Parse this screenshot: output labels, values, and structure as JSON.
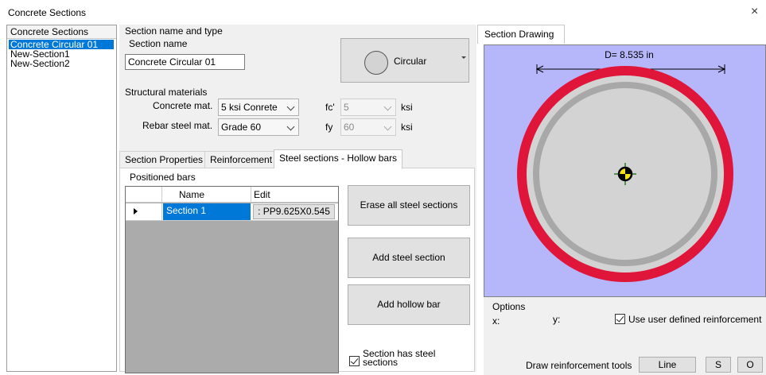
{
  "window": {
    "title": "Concrete Sections",
    "close_glyph": "×"
  },
  "sections_list": {
    "header": "Concrete Sections",
    "items": [
      "Concrete Circular 01",
      "New-Section1",
      "New-Section2"
    ],
    "selected_index": 0
  },
  "section_name_type": {
    "group_label": "Section name and type",
    "name_label": "Section name",
    "name_value": "Concrete Circular 01",
    "type_label": "Circular"
  },
  "materials": {
    "group_label": "Structural materials",
    "concrete_label": "Concrete mat.",
    "concrete_value": "5 ksi Conrete",
    "rebar_label": "Rebar steel mat.",
    "rebar_value": "Grade 60",
    "fc_label": "fc'",
    "fc_value": "5",
    "fy_label": "fy",
    "fy_value": "60",
    "unit_fc": "ksi",
    "unit_fy": "ksi"
  },
  "tabs": [
    {
      "label": "Section Properties",
      "active": false
    },
    {
      "label": "Reinforcement",
      "active": false
    },
    {
      "label": "Steel sections - Hollow bars",
      "active": true
    }
  ],
  "positioned_bars": {
    "group_label": "Positioned bars",
    "columns": [
      "Name",
      "Edit"
    ],
    "rows": [
      {
        "name": "Section 1",
        "edit": ": PP9.625X0.545"
      }
    ]
  },
  "buttons": {
    "erase_all": "Erase all steel sections",
    "add_steel": "Add steel section",
    "add_hollow": "Add hollow bar"
  },
  "has_steel": {
    "label_line1": "Section has steel",
    "label_line2": "sections",
    "checked": true
  },
  "drawing": {
    "tab_label": "Section Drawing",
    "dimension_label": "D= 8.535 in",
    "colors": {
      "background": "#b6b7fb",
      "outer_ring": "#e0153a",
      "inner_ring": "#a8a8a8",
      "core": "#d3d3d3",
      "marker_yellow": "#f5e11a",
      "marker_green": "#2a7d2a"
    }
  },
  "options": {
    "group_label": "Options",
    "x_label": "x:",
    "y_label": "y:",
    "user_defined_label": "Use user defined reinforcement",
    "user_defined_checked": true,
    "tools_label": "Draw reinforcement tools",
    "line_button": "Line",
    "s_button": "S",
    "o_button": "O"
  }
}
